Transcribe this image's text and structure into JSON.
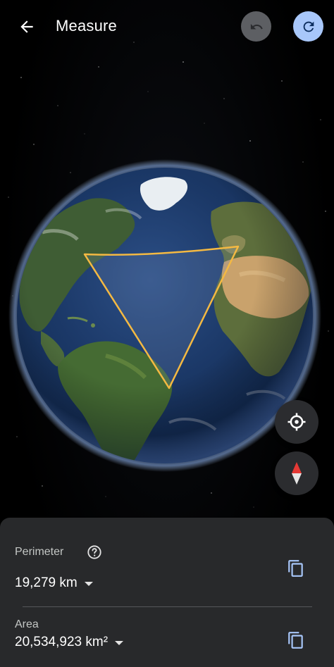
{
  "header": {
    "title": "Measure",
    "back_icon": "arrow-back-icon",
    "undo_icon": "undo-icon",
    "redo_icon": "redo-icon"
  },
  "map": {
    "view": "3D globe centered on the North Atlantic",
    "measured_shape": "triangle polygon",
    "outline_color": "#f4b942"
  },
  "controls": {
    "locate_icon": "my-location-icon",
    "compass_icon": "compass-icon"
  },
  "measurements": {
    "perimeter_label": "Perimeter",
    "perimeter_value": "19,279 km",
    "area_label": "Area",
    "area_value": "20,534,923 km²",
    "help_icon": "help-icon",
    "copy_icon": "copy-icon"
  },
  "colors": {
    "sheet_bg": "#28292b",
    "redo_bg": "#a8c7fa",
    "undo_bg": "#5d5f63",
    "copy_icon": "#a8c7fa"
  }
}
